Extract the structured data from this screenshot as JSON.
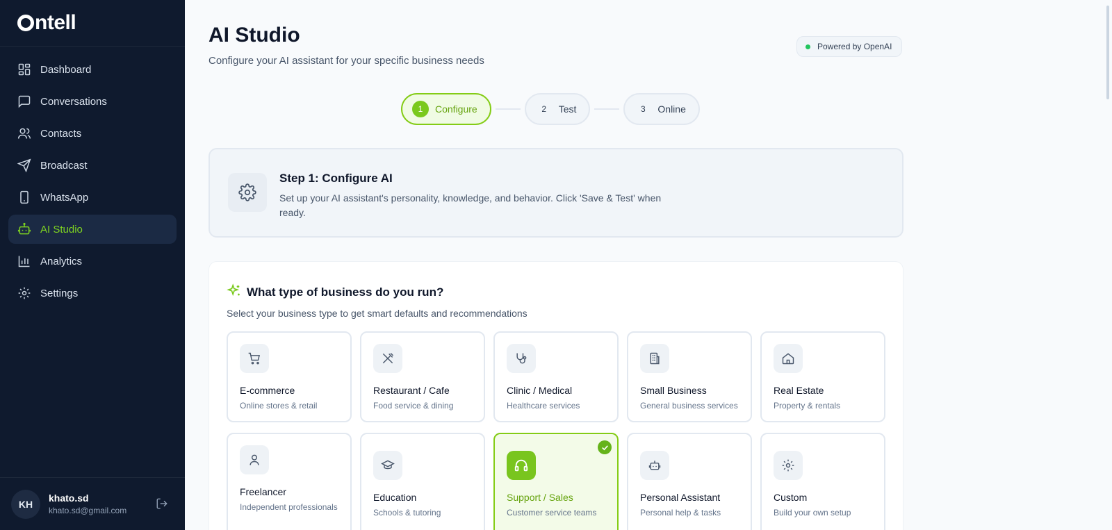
{
  "app": {
    "logo": "ntell"
  },
  "sidebar": {
    "items": [
      {
        "label": "Dashboard",
        "icon": "dashboard-icon",
        "active": false
      },
      {
        "label": "Conversations",
        "icon": "chat-icon",
        "active": false
      },
      {
        "label": "Contacts",
        "icon": "users-icon",
        "active": false
      },
      {
        "label": "Broadcast",
        "icon": "send-icon",
        "active": false
      },
      {
        "label": "WhatsApp",
        "icon": "phone-icon",
        "active": false
      },
      {
        "label": "AI Studio",
        "icon": "bot-icon",
        "active": true
      },
      {
        "label": "Analytics",
        "icon": "bar-chart-icon",
        "active": false
      },
      {
        "label": "Settings",
        "icon": "gear-icon",
        "active": false
      }
    ],
    "user": {
      "initials": "KH",
      "name": "khato.sd",
      "email": "khato.sd@gmail.com"
    }
  },
  "header": {
    "title": "AI Studio",
    "subtitle": "Configure your AI assistant for your specific business needs",
    "powered": "Powered by OpenAI"
  },
  "stepper": [
    {
      "num": "1",
      "label": "Configure",
      "active": true
    },
    {
      "num": "2",
      "label": "Test",
      "active": false
    },
    {
      "num": "3",
      "label": "Online",
      "active": false
    }
  ],
  "info": {
    "title": "Step 1: Configure AI",
    "description": "Set up your AI assistant's personality, knowledge, and behavior. Click 'Save & Test' when ready."
  },
  "business": {
    "title": "What type of business do you run?",
    "subtitle": "Select your business type to get smart defaults and recommendations",
    "types": [
      {
        "name": "E-commerce",
        "desc": "Online stores & retail",
        "icon": "cart-icon",
        "selected": false
      },
      {
        "name": "Restaurant / Cafe",
        "desc": "Food service & dining",
        "icon": "utensils-icon",
        "selected": false
      },
      {
        "name": "Clinic / Medical",
        "desc": "Healthcare services",
        "icon": "stethoscope-icon",
        "selected": false
      },
      {
        "name": "Small Business",
        "desc": "General business services",
        "icon": "building-icon",
        "selected": false
      },
      {
        "name": "Real Estate",
        "desc": "Property & rentals",
        "icon": "house-icon",
        "selected": false
      },
      {
        "name": "Freelancer",
        "desc": "Independent professionals",
        "icon": "person-icon",
        "selected": false
      },
      {
        "name": "Education",
        "desc": "Schools & tutoring",
        "icon": "graduation-cap-icon",
        "selected": false
      },
      {
        "name": "Support / Sales",
        "desc": "Customer service teams",
        "icon": "headphones-icon",
        "selected": true
      },
      {
        "name": "Personal Assistant",
        "desc": "Personal help & tasks",
        "icon": "robot-icon",
        "selected": false
      },
      {
        "name": "Custom",
        "desc": "Build your own setup",
        "icon": "gear-icon",
        "selected": false
      }
    ]
  },
  "colors": {
    "accent": "#7ed321",
    "sidebar_bg": "#0f1a2e",
    "selected_border": "#84cc16"
  }
}
